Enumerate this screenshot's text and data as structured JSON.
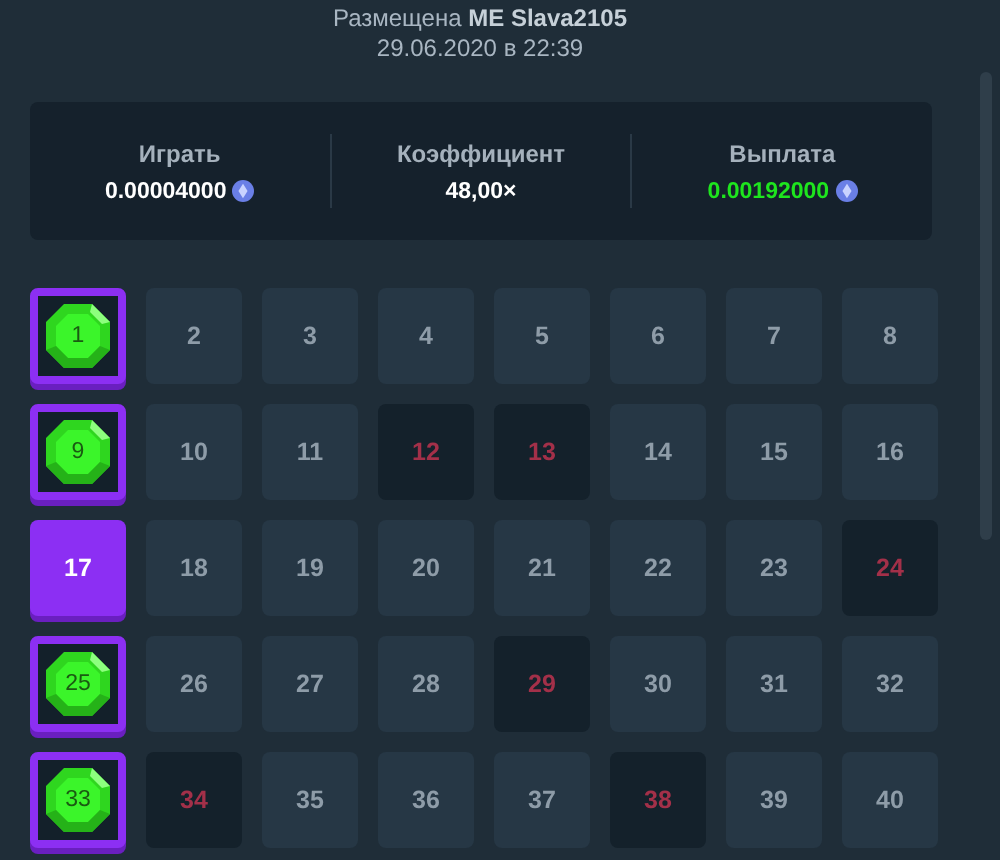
{
  "header": {
    "placed_by": "Размещена **ME Slava2105**",
    "date": "29.06.2020 в 22:39"
  },
  "stats": [
    {
      "label": "Играть",
      "value": "0.00004000",
      "coin": true,
      "highlight": false
    },
    {
      "label": "Коэффициент",
      "value": "48,00×",
      "coin": false,
      "highlight": false
    },
    {
      "label": "Выплата",
      "value": "0.00192000",
      "coin": true,
      "highlight": true
    }
  ],
  "tiles": [
    {
      "number": "1",
      "kind": "gem"
    },
    {
      "number": "2",
      "kind": "plain"
    },
    {
      "number": "3",
      "kind": "plain"
    },
    {
      "number": "4",
      "kind": "plain"
    },
    {
      "number": "5",
      "kind": "plain"
    },
    {
      "number": "6",
      "kind": "plain"
    },
    {
      "number": "7",
      "kind": "plain"
    },
    {
      "number": "8",
      "kind": "plain"
    },
    {
      "number": "9",
      "kind": "gem"
    },
    {
      "number": "10",
      "kind": "plain"
    },
    {
      "number": "11",
      "kind": "plain"
    },
    {
      "number": "12",
      "kind": "miss"
    },
    {
      "number": "13",
      "kind": "miss"
    },
    {
      "number": "14",
      "kind": "plain"
    },
    {
      "number": "15",
      "kind": "plain"
    },
    {
      "number": "16",
      "kind": "plain"
    },
    {
      "number": "17",
      "kind": "picked"
    },
    {
      "number": "18",
      "kind": "plain"
    },
    {
      "number": "19",
      "kind": "plain"
    },
    {
      "number": "20",
      "kind": "plain"
    },
    {
      "number": "21",
      "kind": "plain"
    },
    {
      "number": "22",
      "kind": "plain"
    },
    {
      "number": "23",
      "kind": "plain"
    },
    {
      "number": "24",
      "kind": "miss"
    },
    {
      "number": "25",
      "kind": "gem"
    },
    {
      "number": "26",
      "kind": "plain"
    },
    {
      "number": "27",
      "kind": "plain"
    },
    {
      "number": "28",
      "kind": "plain"
    },
    {
      "number": "29",
      "kind": "miss"
    },
    {
      "number": "30",
      "kind": "plain"
    },
    {
      "number": "31",
      "kind": "plain"
    },
    {
      "number": "32",
      "kind": "plain"
    },
    {
      "number": "33",
      "kind": "gem"
    },
    {
      "number": "34",
      "kind": "miss"
    },
    {
      "number": "35",
      "kind": "plain"
    },
    {
      "number": "36",
      "kind": "plain"
    },
    {
      "number": "37",
      "kind": "plain"
    },
    {
      "number": "38",
      "kind": "miss"
    },
    {
      "number": "39",
      "kind": "plain"
    },
    {
      "number": "40",
      "kind": "plain"
    }
  ]
}
